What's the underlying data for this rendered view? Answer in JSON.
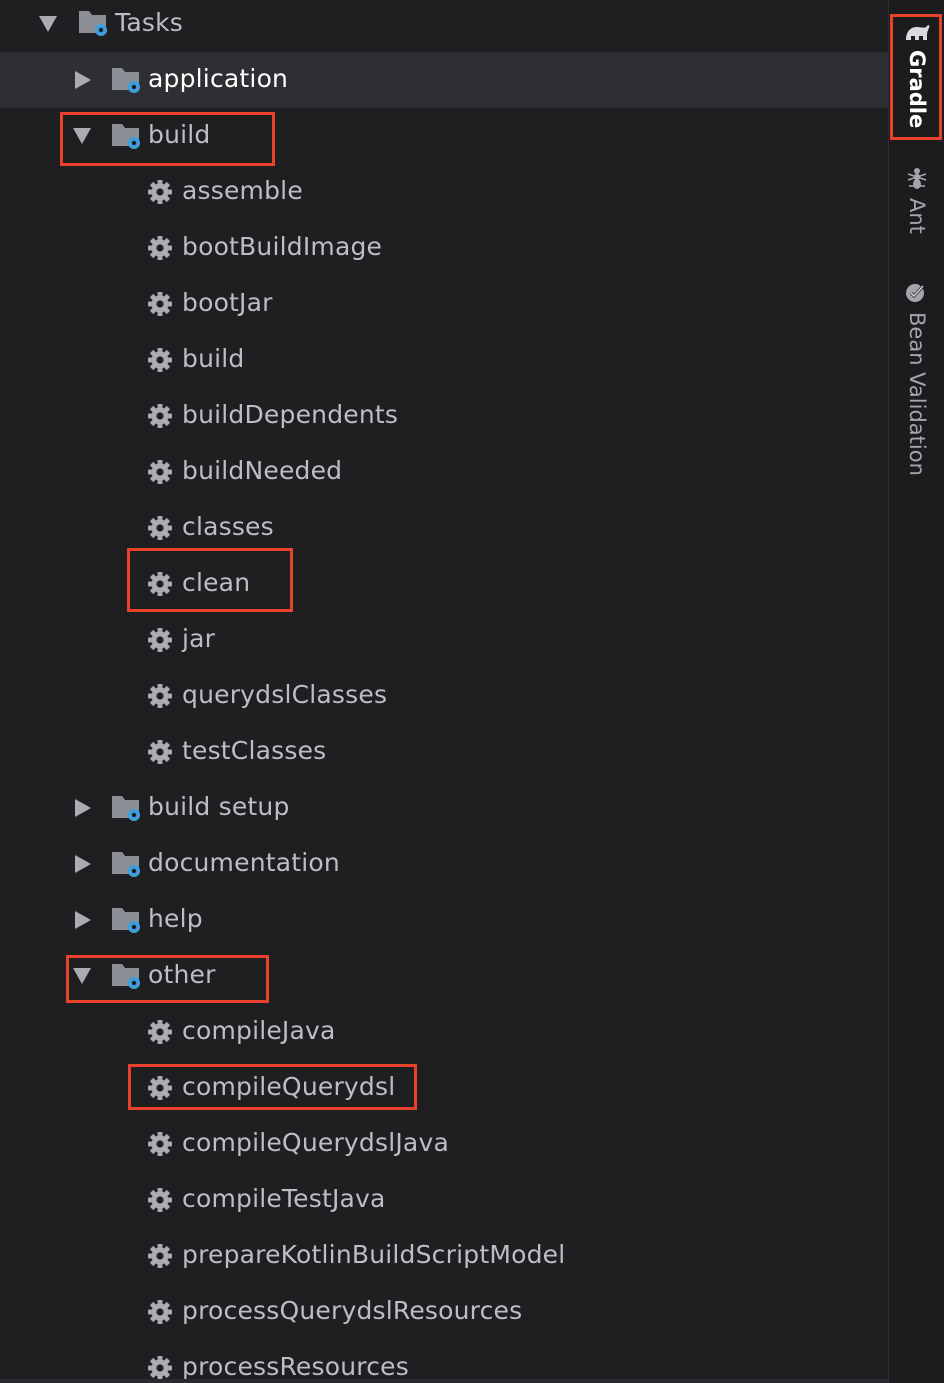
{
  "tree": {
    "root": "Tasks",
    "groups": {
      "application": "application",
      "build": "build",
      "build_setup": "build setup",
      "documentation": "documentation",
      "help": "help",
      "other": "other"
    },
    "build_tasks": [
      "assemble",
      "bootBuildImage",
      "bootJar",
      "build",
      "buildDependents",
      "buildNeeded",
      "classes",
      "clean",
      "jar",
      "querydslClasses",
      "testClasses"
    ],
    "other_tasks": [
      "compileJava",
      "compileQuerydsl",
      "compileQuerydslJava",
      "compileTestJava",
      "prepareKotlinBuildScriptModel",
      "processQuerydslResources",
      "processResources"
    ]
  },
  "sidebar": {
    "tabs": [
      "Gradle",
      "Ant",
      "Bean Validation"
    ],
    "active": "Gradle"
  },
  "colors": {
    "background": "#1f1f21",
    "selected_row": "#2e2f32",
    "highlight_box": "#e8412c",
    "gear_icon": "#a9acb2",
    "folder_icon": "#8c9096",
    "folder_badge": "#3d9fdb"
  },
  "icons": {
    "group": "folder-gear-icon",
    "task": "gear-icon",
    "expanded": "chevron-down-icon",
    "collapsed": "chevron-right-icon",
    "gradle": "elephant-icon",
    "ant": "ant-icon",
    "bean_validation": "bean-validation-icon"
  }
}
